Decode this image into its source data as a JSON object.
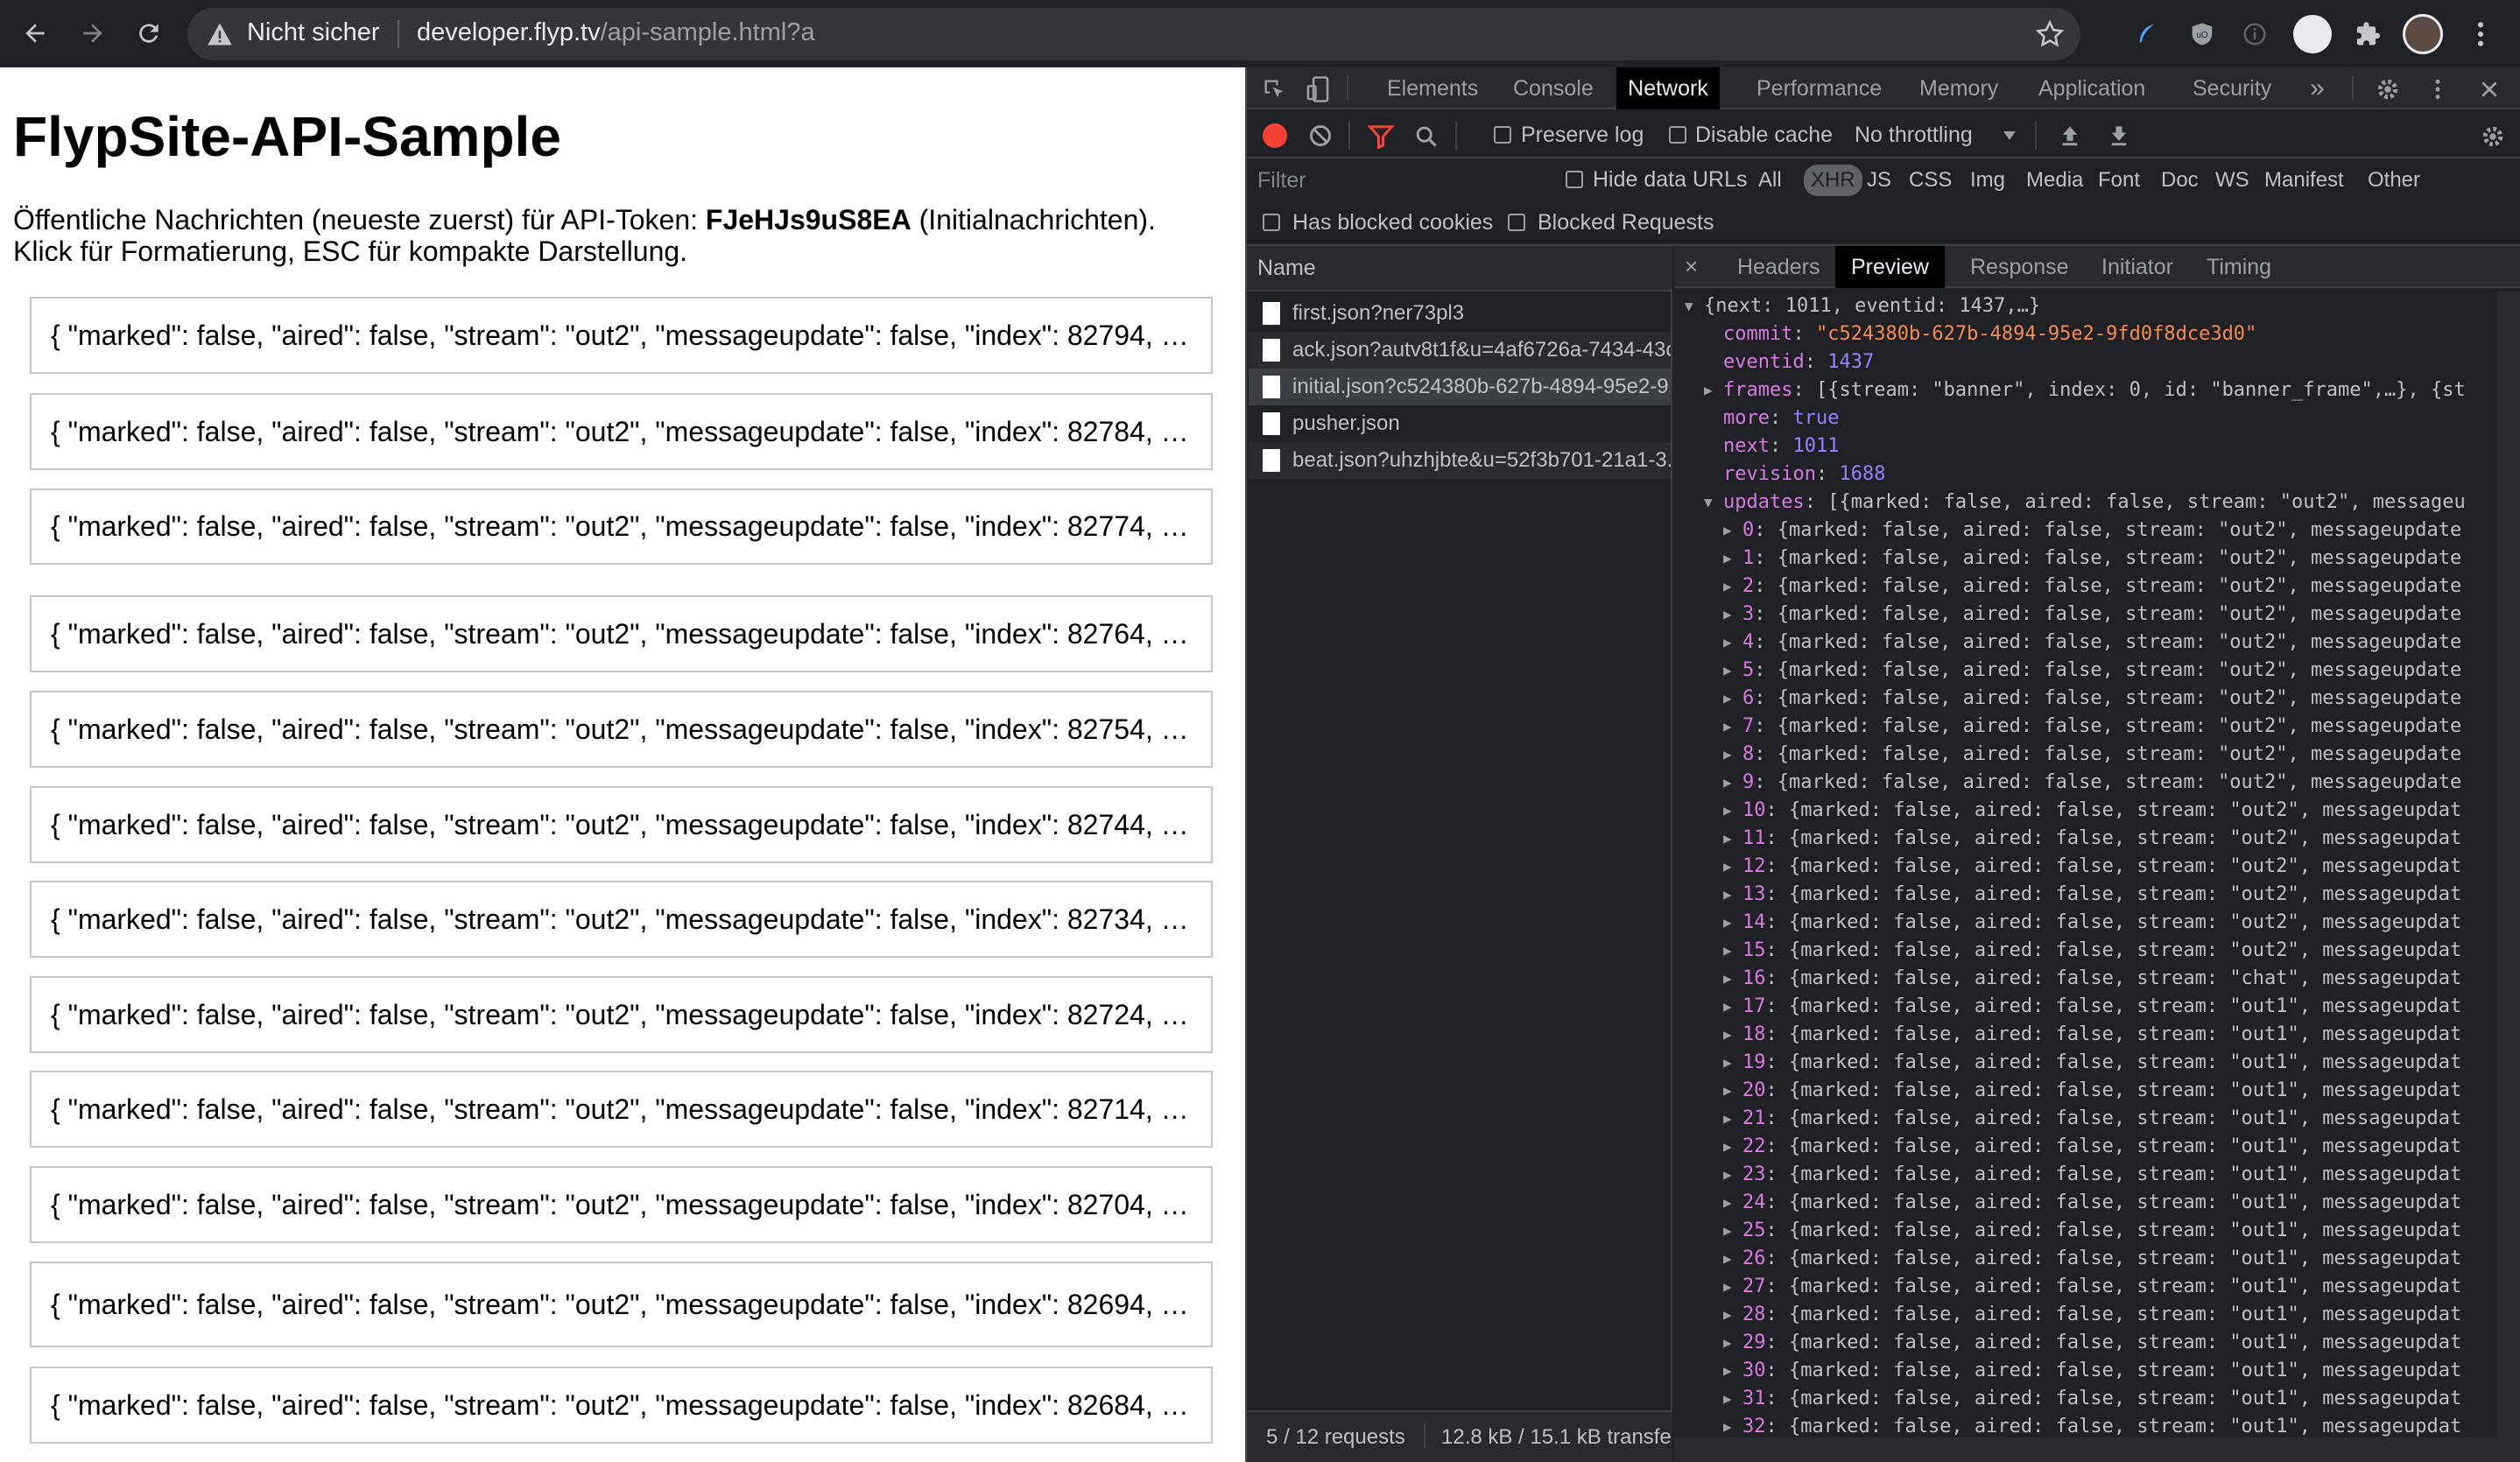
{
  "browser": {
    "security_label": "Nicht sicher",
    "url_host": "developer.flyp.tv",
    "url_path": "/api-sample.html?a"
  },
  "page": {
    "title": "FlypSite-API-Sample",
    "intro_before": "Öffentliche Nachrichten (neueste zuerst) für API-Token: ",
    "token": "FJeHJs9uS8EA",
    "intro_after": " (Initialnachrichten).",
    "intro_line2": "Klick für Formatierung, ESC für kompakte Darstellung.",
    "messages": [
      "{ \"marked\": false, \"aired\": false, \"stream\": \"out2\", \"messageupdate\": false, \"index\": 82794, …",
      "{ \"marked\": false, \"aired\": false, \"stream\": \"out2\", \"messageupdate\": false, \"index\": 82784, …",
      "{ \"marked\": false, \"aired\": false, \"stream\": \"out2\", \"messageupdate\": false, \"index\": 82774, …",
      "{ \"marked\": false, \"aired\": false, \"stream\": \"out2\", \"messageupdate\": false, \"index\": 82764, …",
      "{ \"marked\": false, \"aired\": false, \"stream\": \"out2\", \"messageupdate\": false, \"index\": 82754, …",
      "{ \"marked\": false, \"aired\": false, \"stream\": \"out2\", \"messageupdate\": false, \"index\": 82744, …",
      "{ \"marked\": false, \"aired\": false, \"stream\": \"out2\", \"messageupdate\": false, \"index\": 82734, …",
      "{ \"marked\": false, \"aired\": false, \"stream\": \"out2\", \"messageupdate\": false, \"index\": 82724, …",
      "{ \"marked\": false, \"aired\": false, \"stream\": \"out2\", \"messageupdate\": false, \"index\": 82714, …",
      "{ \"marked\": false, \"aired\": false, \"stream\": \"out2\", \"messageupdate\": false, \"index\": 82704, …",
      "{ \"marked\": false, \"aired\": false, \"stream\": \"out2\", \"messageupdate\": false, \"index\": 82694, …",
      "{ \"marked\": false, \"aired\": false, \"stream\": \"out2\", \"messageupdate\": false, \"index\": 82684, …"
    ]
  },
  "devtools": {
    "tabs": [
      "Elements",
      "Console",
      "Network",
      "Performance",
      "Memory",
      "Application",
      "Security"
    ],
    "active_tab": "Network",
    "more_tabs": "»",
    "toolbar": {
      "preserve_log": "Preserve log",
      "disable_cache": "Disable cache",
      "throttling": "No throttling"
    },
    "filter": {
      "placeholder": "Filter",
      "hide_data_urls": "Hide data URLs",
      "types": [
        "All",
        "XHR",
        "JS",
        "CSS",
        "Img",
        "Media",
        "Font",
        "Doc",
        "WS",
        "Manifest",
        "Other"
      ],
      "active_type": "XHR",
      "has_blocked_cookies": "Has blocked cookies",
      "blocked_requests": "Blocked Requests"
    },
    "requests": {
      "header": "Name",
      "items": [
        "first.json?ner73pl3",
        "ack.json?autv8t1f&u=4af6726a-7434-43c...",
        "initial.json?c524380b-627b-4894-95e2-9...",
        "pusher.json",
        "beat.json?uhzhjbte&u=52f3b701-21a1-3..."
      ],
      "selected_index": 2,
      "status_count": "5 / 12 requests",
      "status_size": "12.8 kB / 15.1 kB transferred"
    },
    "detail_tabs": [
      "Headers",
      "Preview",
      "Response",
      "Initiator",
      "Timing"
    ],
    "active_detail_tab": "Preview",
    "close_label": "×",
    "preview": {
      "root": "{next: 1011, eventid: 1437,…}",
      "commit_key": "commit",
      "commit_value": "\"c524380b-627b-4894-95e2-9fd0f8dce3d0\"",
      "eventid_key": "eventid",
      "eventid_value": "1437",
      "frames_key": "frames",
      "frames_value": "[{stream: \"banner\", index: 0, id: \"banner_frame\",…}, {st",
      "more_key": "more",
      "more_value": "true",
      "next_key": "next",
      "next_value": "1011",
      "revision_key": "revision",
      "revision_value": "1688",
      "updates_key": "updates",
      "updates_value": "[{marked: false, aired: false, stream: \"out2\", messageu",
      "items": [
        {
          "idx": "0",
          "text": "{marked: false, aired: false, stream: \"out2\", messageupdate"
        },
        {
          "idx": "1",
          "text": "{marked: false, aired: false, stream: \"out2\", messageupdate"
        },
        {
          "idx": "2",
          "text": "{marked: false, aired: false, stream: \"out2\", messageupdate"
        },
        {
          "idx": "3",
          "text": "{marked: false, aired: false, stream: \"out2\", messageupdate"
        },
        {
          "idx": "4",
          "text": "{marked: false, aired: false, stream: \"out2\", messageupdate"
        },
        {
          "idx": "5",
          "text": "{marked: false, aired: false, stream: \"out2\", messageupdate"
        },
        {
          "idx": "6",
          "text": "{marked: false, aired: false, stream: \"out2\", messageupdate"
        },
        {
          "idx": "7",
          "text": "{marked: false, aired: false, stream: \"out2\", messageupdate"
        },
        {
          "idx": "8",
          "text": "{marked: false, aired: false, stream: \"out2\", messageupdate"
        },
        {
          "idx": "9",
          "text": "{marked: false, aired: false, stream: \"out2\", messageupdate"
        },
        {
          "idx": "10",
          "text": "{marked: false, aired: false, stream: \"out2\", messageupdat"
        },
        {
          "idx": "11",
          "text": "{marked: false, aired: false, stream: \"out2\", messageupdat"
        },
        {
          "idx": "12",
          "text": "{marked: false, aired: false, stream: \"out2\", messageupdat"
        },
        {
          "idx": "13",
          "text": "{marked: false, aired: false, stream: \"out2\", messageupdat"
        },
        {
          "idx": "14",
          "text": "{marked: false, aired: false, stream: \"out2\", messageupdat"
        },
        {
          "idx": "15",
          "text": "{marked: false, aired: false, stream: \"out2\", messageupdat"
        },
        {
          "idx": "16",
          "text": "{marked: false, aired: false, stream: \"chat\", messageupdat"
        },
        {
          "idx": "17",
          "text": "{marked: false, aired: false, stream: \"out1\", messageupdat"
        },
        {
          "idx": "18",
          "text": "{marked: false, aired: false, stream: \"out1\", messageupdat"
        },
        {
          "idx": "19",
          "text": "{marked: false, aired: false, stream: \"out1\", messageupdat"
        },
        {
          "idx": "20",
          "text": "{marked: false, aired: false, stream: \"out1\", messageupdat"
        },
        {
          "idx": "21",
          "text": "{marked: false, aired: false, stream: \"out1\", messageupdat"
        },
        {
          "idx": "22",
          "text": "{marked: false, aired: false, stream: \"out1\", messageupdat"
        },
        {
          "idx": "23",
          "text": "{marked: false, aired: false, stream: \"out1\", messageupdat"
        },
        {
          "idx": "24",
          "text": "{marked: false, aired: false, stream: \"out1\", messageupdat"
        },
        {
          "idx": "25",
          "text": "{marked: false, aired: false, stream: \"out1\", messageupdat"
        },
        {
          "idx": "26",
          "text": "{marked: false, aired: false, stream: \"out1\", messageupdat"
        },
        {
          "idx": "27",
          "text": "{marked: false, aired: false, stream: \"out1\", messageupdat"
        },
        {
          "idx": "28",
          "text": "{marked: false, aired: false, stream: \"out1\", messageupdat"
        },
        {
          "idx": "29",
          "text": "{marked: false, aired: false, stream: \"out1\", messageupdat"
        },
        {
          "idx": "30",
          "text": "{marked: false, aired: false, stream: \"out1\", messageupdat"
        },
        {
          "idx": "31",
          "text": "{marked: false, aired: false, stream: \"out1\", messageupdat"
        },
        {
          "idx": "32",
          "text": "{marked: false, aired: false, stream: \"out1\", messageupdat"
        }
      ]
    }
  },
  "icons": {
    "back": "back-arrow-icon",
    "forward": "forward-arrow-icon",
    "reload": "reload-icon",
    "warning": "warning-icon",
    "star": "star-icon",
    "settings": "gear-icon"
  },
  "colors": {
    "chrome_bg": "#202124",
    "devtools_bg": "#202124",
    "json_key": "#d67ce0",
    "json_number": "#9980ff",
    "json_string": "#f28b54",
    "record": "#f44336",
    "filter_active": "#f44336"
  }
}
